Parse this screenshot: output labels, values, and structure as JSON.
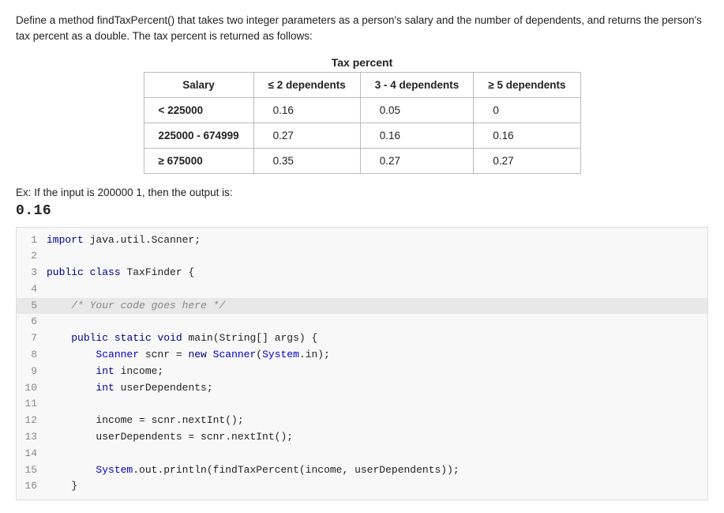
{
  "description": "Define a method findTaxPercent() that takes two integer parameters as a person's salary and the number of dependents, and returns the person's tax percent as a double. The tax percent is returned as follows:",
  "table": {
    "title": "Tax percent",
    "headers": [
      "Salary",
      "≤ 2 dependents",
      "3 - 4 dependents",
      "≥ 5 dependents"
    ],
    "rows": [
      {
        "salary": "< 225000",
        "col1": "0.16",
        "col2": "0.05",
        "col3": "0"
      },
      {
        "salary": "225000 - 674999",
        "col1": "0.27",
        "col2": "0.16",
        "col3": "0.16"
      },
      {
        "salary": "≥ 675000",
        "col1": "0.35",
        "col2": "0.27",
        "col3": "0.27"
      }
    ]
  },
  "example": {
    "text": "Ex: If the input is 200000 1, then the output is:",
    "output": "0.16"
  },
  "code": {
    "lines": [
      {
        "num": 1,
        "content": "import java.util.Scanner;",
        "highlight": false
      },
      {
        "num": 2,
        "content": "",
        "highlight": false
      },
      {
        "num": 3,
        "content": "public class TaxFinder {",
        "highlight": false
      },
      {
        "num": 4,
        "content": "",
        "highlight": false
      },
      {
        "num": 5,
        "content": "   /* Your code goes here */",
        "highlight": true
      },
      {
        "num": 6,
        "content": "",
        "highlight": false
      },
      {
        "num": 7,
        "content": "   public static void main(String[] args) {",
        "highlight": false
      },
      {
        "num": 8,
        "content": "      Scanner scnr = new Scanner(System.in);",
        "highlight": false
      },
      {
        "num": 9,
        "content": "      int income;",
        "highlight": false
      },
      {
        "num": 10,
        "content": "      int userDependents;",
        "highlight": false
      },
      {
        "num": 11,
        "content": "",
        "highlight": false
      },
      {
        "num": 12,
        "content": "      income = scnr.nextInt();",
        "highlight": false
      },
      {
        "num": 13,
        "content": "      userDependents = scnr.nextInt();",
        "highlight": false
      },
      {
        "num": 14,
        "content": "",
        "highlight": false
      },
      {
        "num": 15,
        "content": "      System.out.println(findTaxPercent(income, userDependents));",
        "highlight": false
      },
      {
        "num": 16,
        "content": "   }",
        "highlight": false
      }
    ]
  }
}
